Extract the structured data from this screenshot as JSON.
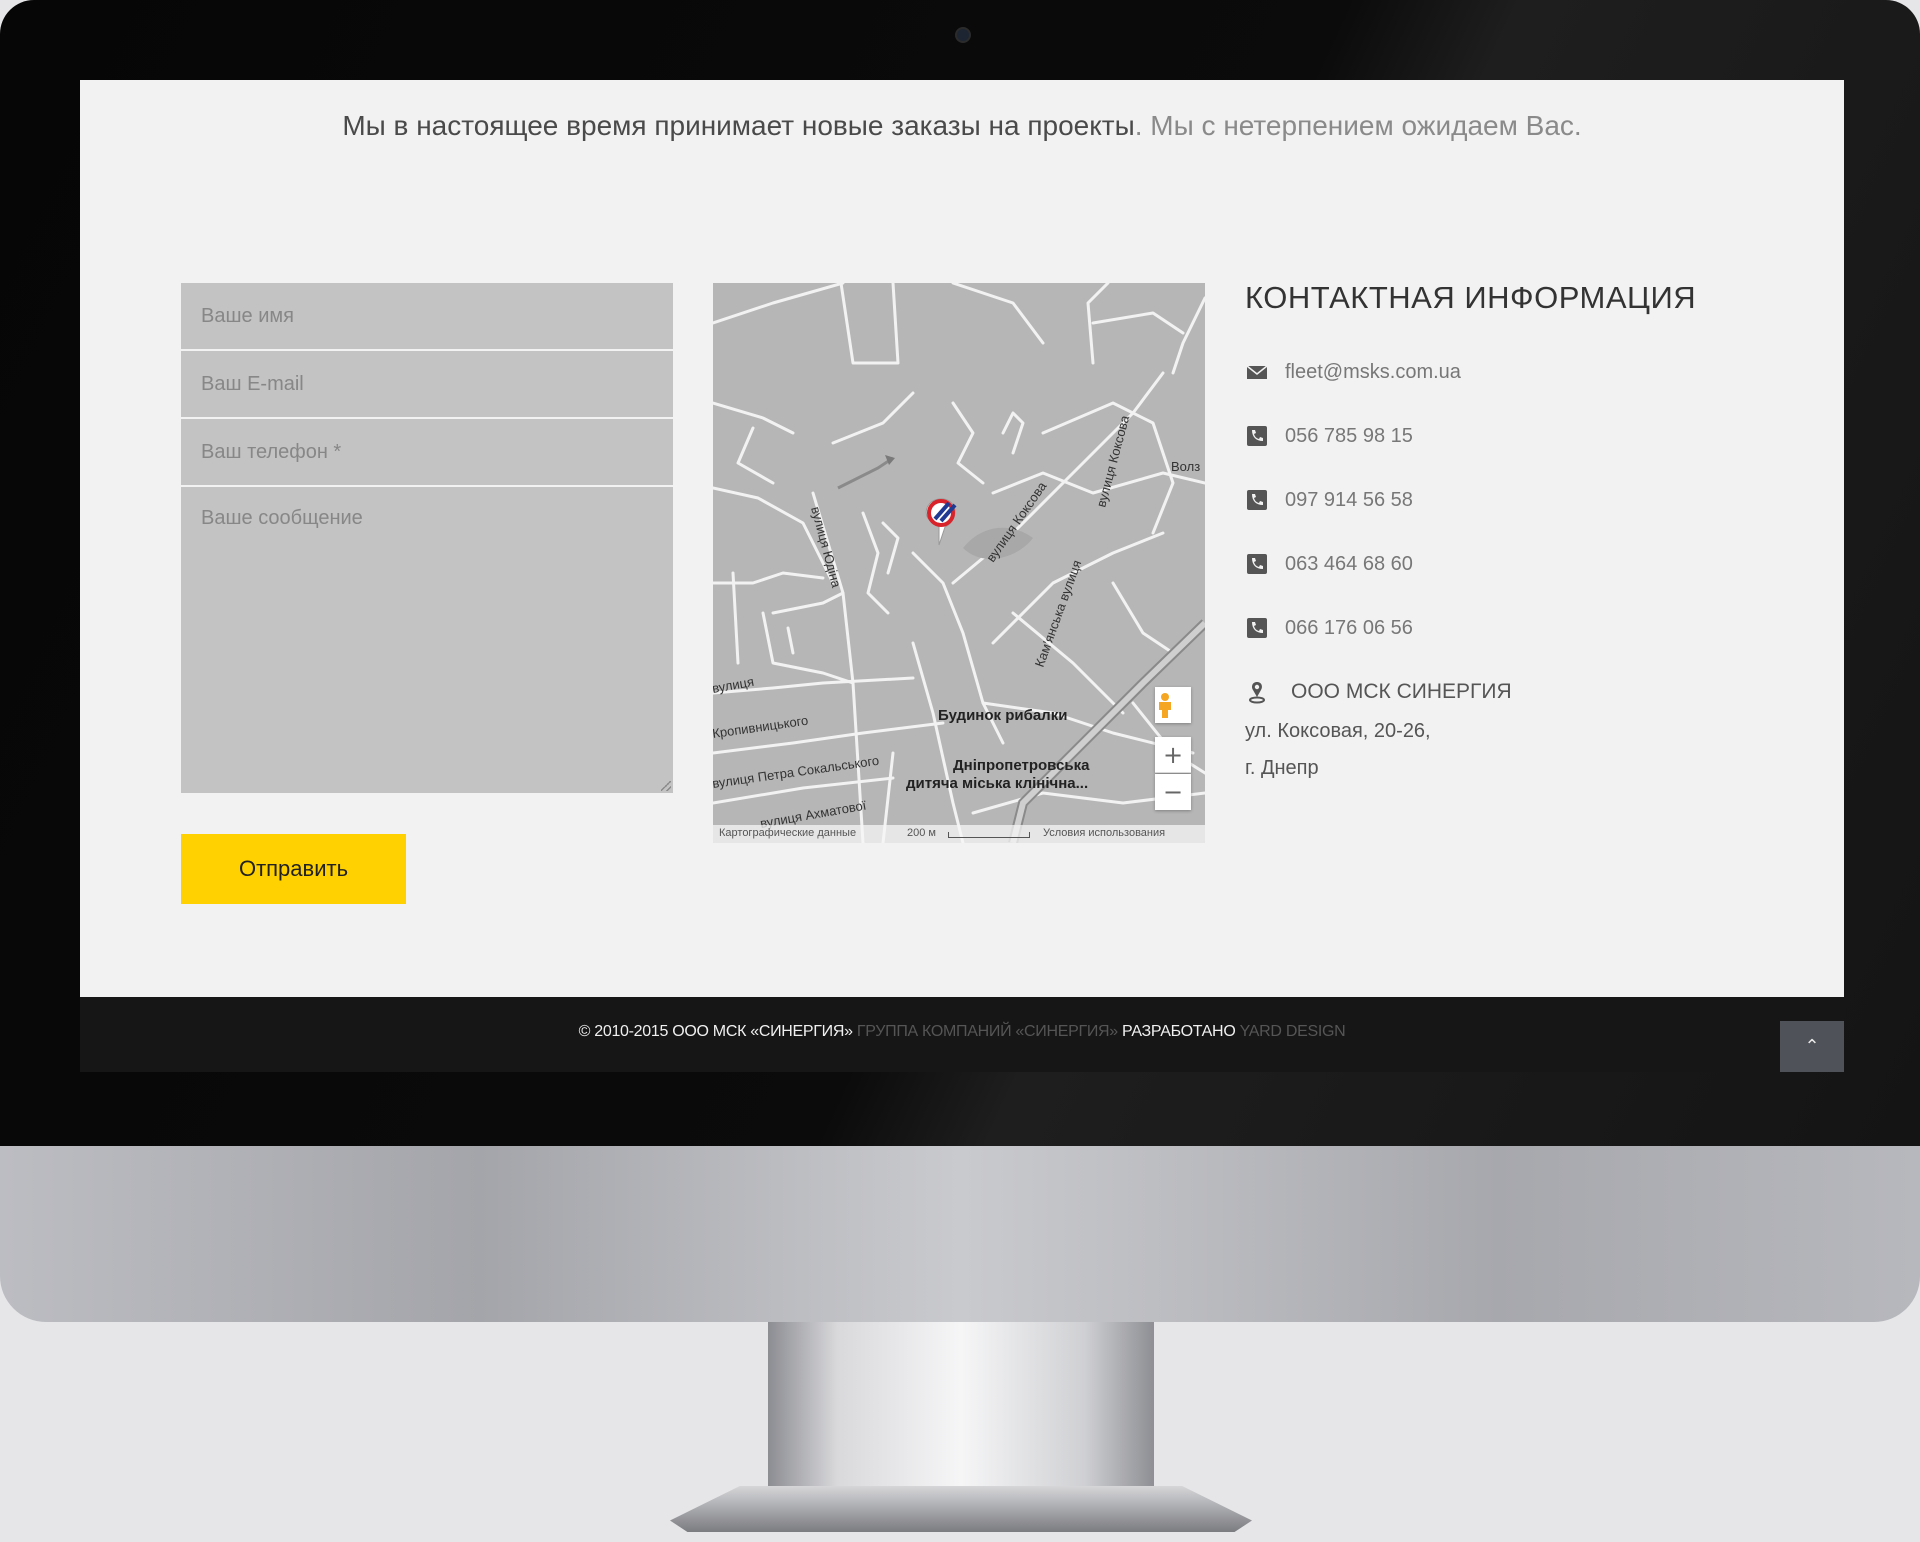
{
  "tagline": {
    "main": "Мы в настоящее время принимает новые заказы на проекты",
    "secondary": ". Мы с нетерпением ожидаем Вас."
  },
  "form": {
    "name_placeholder": "Ваше имя",
    "email_placeholder": "Ваш E-mail",
    "phone_placeholder": "Ваш телефон *",
    "message_placeholder": "Ваше сообщение",
    "submit_label": "Отправить",
    "accent_color": "#ffd100"
  },
  "map": {
    "streets": [
      "вулиця Юдіна",
      "вулиця Коксова",
      "вулиця Коксова",
      "Кам'янська вулиця",
      "вулиця",
      "Кропивницького",
      "вулиця Петра Сокальського",
      "вулиця Ахматової",
      "Волз"
    ],
    "pois": [
      "Будинок рибалки",
      "Дніпропетровська",
      "дитяча міська клінічна..."
    ],
    "footer": {
      "data_label": "Картографические данные",
      "scale_label": "200 м",
      "terms_label": "Условия использования"
    },
    "controls": {
      "zoom_in": "+",
      "zoom_out": "−"
    },
    "pin_icon": "company-logo-pin-icon"
  },
  "contacts": {
    "title": "КОНТАКТНАЯ ИНФОРМАЦИЯ",
    "email": "fleet@msks.com.ua",
    "phones": [
      "056 785 98 15",
      "097 914 56 58",
      "063 464 68 60",
      "066 176 06 56"
    ],
    "company": "ООО МСК СИНЕРГИЯ",
    "street": "ул. Коксовая, 20-26,",
    "city": "г. Днепр"
  },
  "footer": {
    "copyright": "© 2010-2015 ООО МСК «СИНЕРГИЯ»",
    "group": " ГРУППА КОМПАНИЙ «СИНЕРГИЯ» ",
    "developed_label": "РАЗРАБОТАНО",
    "developer": " YARD DESIGN",
    "scroll_top_icon": "chevron-up-icon"
  }
}
